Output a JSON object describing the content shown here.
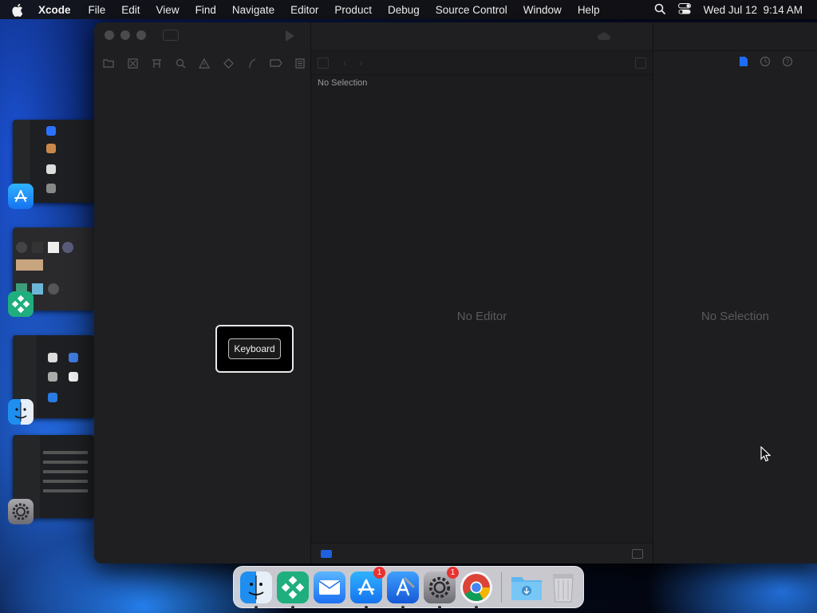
{
  "menubar": {
    "app_name": "Xcode",
    "menus": [
      "File",
      "Edit",
      "View",
      "Find",
      "Navigate",
      "Editor",
      "Product",
      "Debug",
      "Source Control",
      "Window",
      "Help"
    ],
    "datetime": "Wed Jul 12  9:14 AM"
  },
  "xcode": {
    "editor_breadcrumb": "No Selection",
    "editor_placeholder": "No Editor",
    "inspector_placeholder": "No Selection"
  },
  "popup": {
    "button_label": "Keyboard"
  },
  "stage_manager": {
    "apps": [
      "app-store-icon",
      "zoom-like-icon",
      "finder-icon",
      "system-settings-icon"
    ]
  },
  "dock": {
    "items": [
      {
        "name": "finder-icon",
        "badge": ""
      },
      {
        "name": "diamond-app-icon",
        "badge": ""
      },
      {
        "name": "mail-icon",
        "badge": ""
      },
      {
        "name": "app-store-icon",
        "badge": "1"
      },
      {
        "name": "xcode-icon",
        "badge": ""
      },
      {
        "name": "system-settings-icon",
        "badge": "1"
      },
      {
        "name": "chrome-icon",
        "badge": ""
      },
      {
        "name": "downloads-folder-icon",
        "badge": ""
      },
      {
        "name": "trash-icon",
        "badge": ""
      }
    ]
  },
  "colors": {
    "accent_blue": "#1e6cff",
    "badge_red": "#e8322f"
  }
}
